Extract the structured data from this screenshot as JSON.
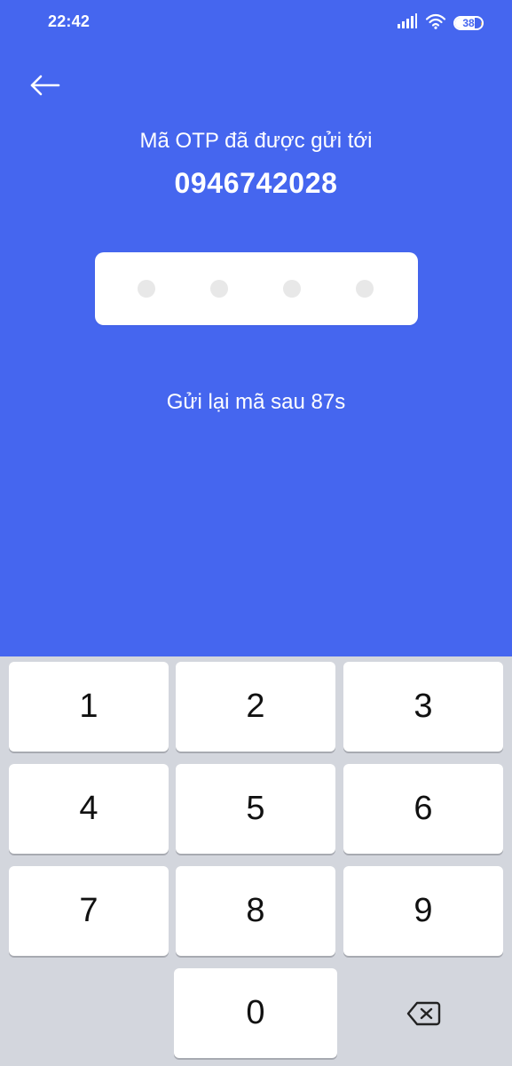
{
  "status_bar": {
    "time": "22:42",
    "battery_level": "38",
    "icons": [
      "signal-icon",
      "wifi-icon",
      "battery-icon"
    ]
  },
  "header": {
    "back_icon": "arrow-left-icon",
    "title": "Mã OTP đã được gửi tới",
    "phone_number": "0946742028"
  },
  "otp": {
    "length": 4,
    "entered": 0
  },
  "resend": {
    "text": "Gửi lại mã sau 87s"
  },
  "keypad": {
    "keys": [
      "1",
      "2",
      "3",
      "4",
      "5",
      "6",
      "7",
      "8",
      "9",
      "0"
    ],
    "backspace_icon": "backspace-icon"
  },
  "colors": {
    "primary_blue": "#4566EF",
    "keypad_bg": "#D3D6DD",
    "key_bg": "#FFFFFF",
    "dot_gray": "#E8E8E8",
    "battery_accent": "#F2B42F"
  }
}
